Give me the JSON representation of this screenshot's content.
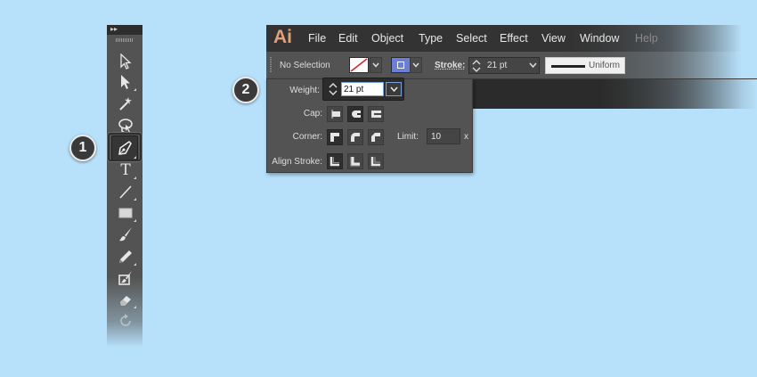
{
  "callouts": {
    "step1": "1",
    "step2": "2"
  },
  "tools_panel": {
    "collapse_glyph": "▸▸",
    "tools": [
      {
        "name": "selection-tool-icon"
      },
      {
        "name": "direct-selection-tool-icon"
      },
      {
        "name": "magic-wand-tool-icon"
      },
      {
        "name": "lasso-tool-icon"
      },
      {
        "name": "pen-tool-icon",
        "active": true
      },
      {
        "name": "type-tool-icon",
        "glyph": "T"
      },
      {
        "name": "line-segment-tool-icon"
      },
      {
        "name": "rectangle-tool-icon"
      },
      {
        "name": "paintbrush-tool-icon"
      },
      {
        "name": "pencil-tool-icon"
      },
      {
        "name": "blob-brush-tool-icon"
      },
      {
        "name": "eraser-tool-icon"
      },
      {
        "name": "rotate-tool-icon"
      }
    ]
  },
  "app": {
    "logo": "Ai",
    "logo_color": "#e0a17c",
    "menu": [
      "File",
      "Edit",
      "Object",
      "Type",
      "Select",
      "Effect",
      "View",
      "Window",
      "Help"
    ],
    "control_bar": {
      "selection_status": "No Selection",
      "stroke_label": "Stroke:",
      "stroke_weight": "21 pt",
      "profile": "Uniform",
      "stroke_color": "#6c7fd1"
    }
  },
  "stroke_panel": {
    "weight_label": "Weight:",
    "weight_value": "21 pt",
    "cap_label": "Cap:",
    "corner_label": "Corner:",
    "limit_label": "Limit:",
    "limit_value": "10",
    "limit_unit": "x",
    "align_label": "Align Stroke:"
  }
}
